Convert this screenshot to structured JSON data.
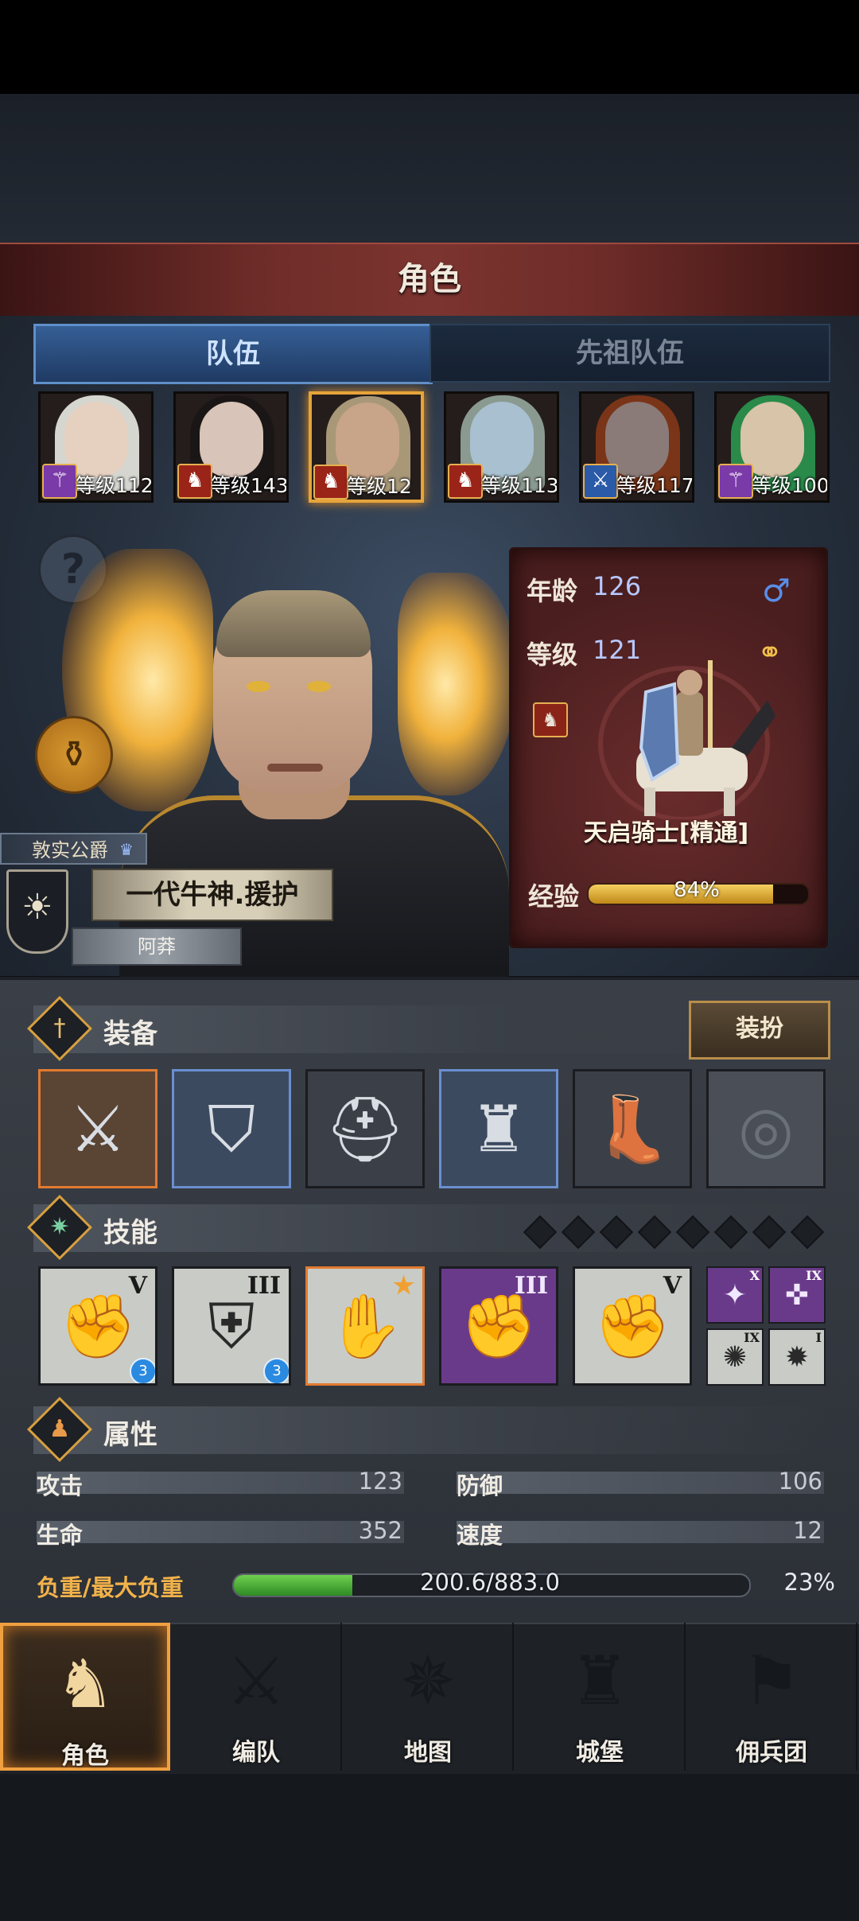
{
  "header": {
    "title": "角色"
  },
  "tabs": [
    {
      "label": "队伍",
      "active": true
    },
    {
      "label": "先祖队伍",
      "active": false
    }
  ],
  "heroes": [
    {
      "level_text": "等级112",
      "class_icon": "staff-icon",
      "class_color": "#7a3aa8",
      "hair": "#d6d6d0",
      "skin": "#e6d0c0",
      "selected": false
    },
    {
      "level_text": "等级143",
      "class_icon": "horse-icon",
      "class_color": "#9a2418",
      "hair": "#1a1616",
      "skin": "#d8c4b8",
      "selected": false
    },
    {
      "level_text": "等级12",
      "class_icon": "horse-icon",
      "class_color": "#9a2418",
      "hair": "#a89878",
      "skin": "#c8a488",
      "selected": true
    },
    {
      "level_text": "等级113",
      "class_icon": "horse-icon",
      "class_color": "#9a2418",
      "hair": "#8a9a90",
      "skin": "#a8c0d0",
      "selected": false
    },
    {
      "level_text": "等级117",
      "class_icon": "sword-icon",
      "class_color": "#2a5aa8",
      "hair": "#7a3418",
      "skin": "#8a7a78",
      "selected": false
    },
    {
      "level_text": "等级100",
      "class_icon": "staff-icon",
      "class_color": "#7a3aa8",
      "hair": "#2a8a4a",
      "skin": "#d8c4a8",
      "selected": false
    }
  ],
  "character": {
    "rank_title": "敦实公爵",
    "name": "一代牛神.援护",
    "player_name": "阿莽",
    "info": {
      "age_label": "年龄",
      "age": "126",
      "level_label": "等级",
      "level": "121",
      "class_name": "天启骑士[精通]",
      "exp_label": "经验",
      "exp_text": "84%",
      "exp_fraction": 0.84
    }
  },
  "equipment": {
    "section_title": "装备",
    "dress_button": "装扮",
    "slots": [
      {
        "name": "sword",
        "icon": "⚔",
        "style": "orange"
      },
      {
        "name": "shield",
        "icon": "⛉",
        "style": "blue"
      },
      {
        "name": "helmet",
        "icon": "⛑",
        "style": "plain"
      },
      {
        "name": "armor",
        "icon": "♜",
        "style": "blue"
      },
      {
        "name": "boots",
        "icon": "👢",
        "style": "plain"
      },
      {
        "name": "ring-empty",
        "icon": "◎",
        "style": "empty"
      }
    ]
  },
  "skills": {
    "section_title": "技能",
    "slot_diamonds": 8,
    "main": [
      {
        "rank": "V",
        "icon": "✊",
        "badge": "3",
        "style": "plain"
      },
      {
        "rank": "III",
        "icon": "⛨",
        "badge": "3",
        "style": "plain"
      },
      {
        "rank": "★",
        "icon": "✋",
        "badge": "",
        "style": "orange"
      },
      {
        "rank": "III",
        "icon": "✊",
        "badge": "",
        "style": "purple"
      },
      {
        "rank": "V",
        "icon": "✊",
        "badge": "",
        "style": "plain"
      }
    ],
    "mini": [
      {
        "rank": "X",
        "icon": "✦",
        "style": "purple"
      },
      {
        "rank": "IX",
        "icon": "✜",
        "style": "purple"
      },
      {
        "rank": "IX",
        "icon": "✺",
        "style": "plain"
      },
      {
        "rank": "I",
        "icon": "✹",
        "style": "plain"
      }
    ]
  },
  "attributes": {
    "section_title": "属性",
    "stats": [
      {
        "label": "攻击",
        "value": "123"
      },
      {
        "label": "防御",
        "value": "106"
      },
      {
        "label": "生命",
        "value": "352"
      },
      {
        "label": "速度",
        "value": "12"
      }
    ],
    "load_label": "负重/最大负重",
    "load_text": "200.6/883.0",
    "load_percent": "23%",
    "load_fraction": 0.23
  },
  "nav": [
    {
      "label": "角色",
      "icon": "♞",
      "active": true
    },
    {
      "label": "编队",
      "icon": "⚔",
      "active": false
    },
    {
      "label": "地图",
      "icon": "✵",
      "active": false
    },
    {
      "label": "城堡",
      "icon": "♜",
      "active": false
    },
    {
      "label": "佣兵团",
      "icon": "⚑",
      "active": false
    }
  ],
  "colors": {
    "accent": "#f0a040",
    "tab_active": "#365f96",
    "exp_fill": "#f5d060",
    "load_fill": "#6fd050"
  }
}
